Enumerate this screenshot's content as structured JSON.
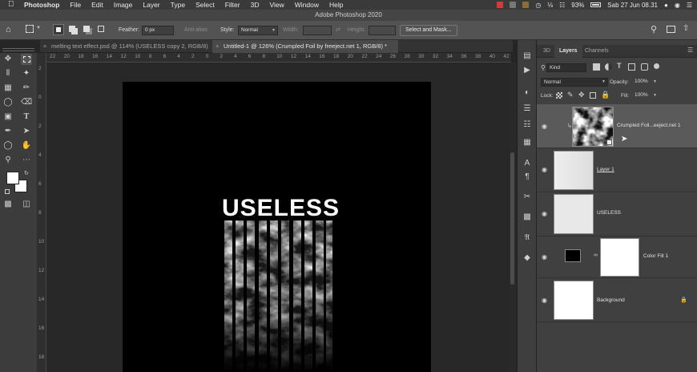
{
  "menubar": {
    "app_name": "Photoshop",
    "items": [
      "File",
      "Edit",
      "Image",
      "Layer",
      "Type",
      "Select",
      "Filter",
      "3D",
      "View",
      "Window",
      "Help"
    ],
    "battery": "93%",
    "datetime": "Sab 27 Jun 08.31"
  },
  "window_title": "Adobe Photoshop 2020",
  "options": {
    "feather_label": "Feather:",
    "feather_value": "0 px",
    "antialias_label": "Anti-alias",
    "style_label": "Style:",
    "style_value": "Normal",
    "width_label": "Width:",
    "height_label": "Height:",
    "select_mask_label": "Select and Mask..."
  },
  "tabs": [
    {
      "label": "melting text effect.psd @ 114% (USELESS copy 2, RGB/8)"
    },
    {
      "label": "Untitled-1 @ 126% (Crumpled Foil by freeject.net 1, RGB/8) *"
    }
  ],
  "ruler": {
    "h": [
      "22",
      "20",
      "18",
      "16",
      "14",
      "12",
      "10",
      "8",
      "6",
      "4",
      "2",
      "0",
      "2",
      "4",
      "6",
      "8",
      "10",
      "12",
      "14",
      "16",
      "18",
      "20",
      "22",
      "24",
      "26",
      "28",
      "30",
      "32",
      "34",
      "36",
      "38",
      "40",
      "42"
    ],
    "v": [
      "2",
      "0",
      "2",
      "4",
      "6",
      "8",
      "10",
      "12",
      "14",
      "16",
      "18"
    ]
  },
  "canvas_text": "USELESS",
  "panel": {
    "tabs": [
      "3D",
      "Layers",
      "Channels"
    ],
    "kind_value": "Kind",
    "blend_value": "Normal",
    "opacity_label": "Opacity:",
    "opacity_value": "100%",
    "lock_label": "Lock:",
    "fill_label": "Fill:",
    "fill_value": "100%",
    "layers": [
      {
        "name": "Crumpled Foil...eeject.net 1"
      },
      {
        "name": "Layer 1"
      },
      {
        "name": "USELESS"
      },
      {
        "name": "Color Fill 1"
      },
      {
        "name": "Background"
      }
    ]
  },
  "colors": {
    "menubar_bg": "#3a3a3a",
    "options_bg": "#535353",
    "panel_bg": "#404040",
    "selected_layer": "#5a5a5a",
    "canvas_bg": "#000000"
  }
}
